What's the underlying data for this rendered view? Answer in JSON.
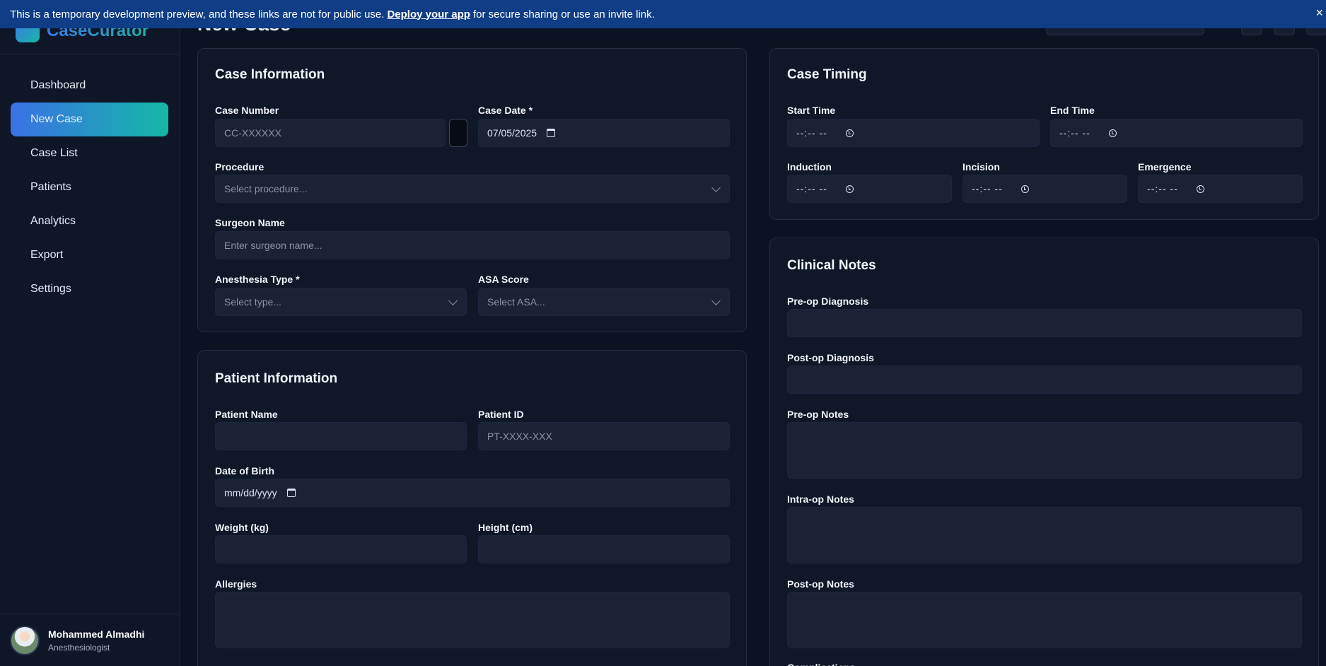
{
  "banner": {
    "text_before": "This is a temporary development preview, and these links are not for public use.",
    "link": "Deploy your app",
    "text_after": "for secure sharing or use an invite link.",
    "close": "×"
  },
  "app": {
    "logo_text": "CaseCurator"
  },
  "page": {
    "title": "New Case"
  },
  "sidebar": {
    "items": [
      {
        "label": "Dashboard"
      },
      {
        "label": "New Case"
      },
      {
        "label": "Case List"
      },
      {
        "label": "Patients"
      },
      {
        "label": "Analytics"
      },
      {
        "label": "Export"
      },
      {
        "label": "Settings"
      }
    ],
    "active_index": 1
  },
  "user": {
    "name": "Mohammed Almadhi",
    "role": "Anesthesiologist"
  },
  "case_info": {
    "title": "Case Information",
    "case_number": {
      "label": "Case Number",
      "placeholder": "CC-XXXXXX"
    },
    "case_date": {
      "label": "Case Date *",
      "value": "07/05/2025"
    },
    "procedure": {
      "label": "Procedure",
      "placeholder": "Select procedure..."
    },
    "surgeon": {
      "label": "Surgeon Name",
      "placeholder": "Enter surgeon name..."
    },
    "anesthesia": {
      "label": "Anesthesia Type *",
      "placeholder": "Select type..."
    },
    "asa": {
      "label": "ASA Score",
      "placeholder": "Select ASA..."
    }
  },
  "patient_info": {
    "title": "Patient Information",
    "name": {
      "label": "Patient Name",
      "value": ""
    },
    "id": {
      "label": "Patient ID",
      "placeholder": "PT-XXXX-XXX"
    },
    "dob": {
      "label": "Date of Birth",
      "placeholder": "mm/dd/yyyy"
    },
    "weight": {
      "label": "Weight (kg)"
    },
    "height": {
      "label": "Height (cm)"
    },
    "allergies": {
      "label": "Allergies"
    }
  },
  "timing": {
    "title": "Case Timing",
    "start": {
      "label": "Start Time",
      "value": "--:-- --"
    },
    "end": {
      "label": "End Time",
      "value": "--:-- --"
    },
    "induction": {
      "label": "Induction",
      "value": "--:-- --"
    },
    "incision": {
      "label": "Incision",
      "value": "--:-- --"
    },
    "emergence": {
      "label": "Emergence",
      "value": "--:-- --"
    }
  },
  "notes": {
    "title": "Clinical Notes",
    "preop_dx": "Pre-op Diagnosis",
    "postop_dx": "Post-op Diagnosis",
    "preop_notes": "Pre-op Notes",
    "intraop_notes": "Intra-op Notes",
    "postop_notes": "Post-op Notes",
    "next_label": "Complications"
  },
  "colors": {
    "accent_start": "#3a71e6",
    "accent_end": "#14b8a6",
    "banner": "#0f3d86"
  }
}
